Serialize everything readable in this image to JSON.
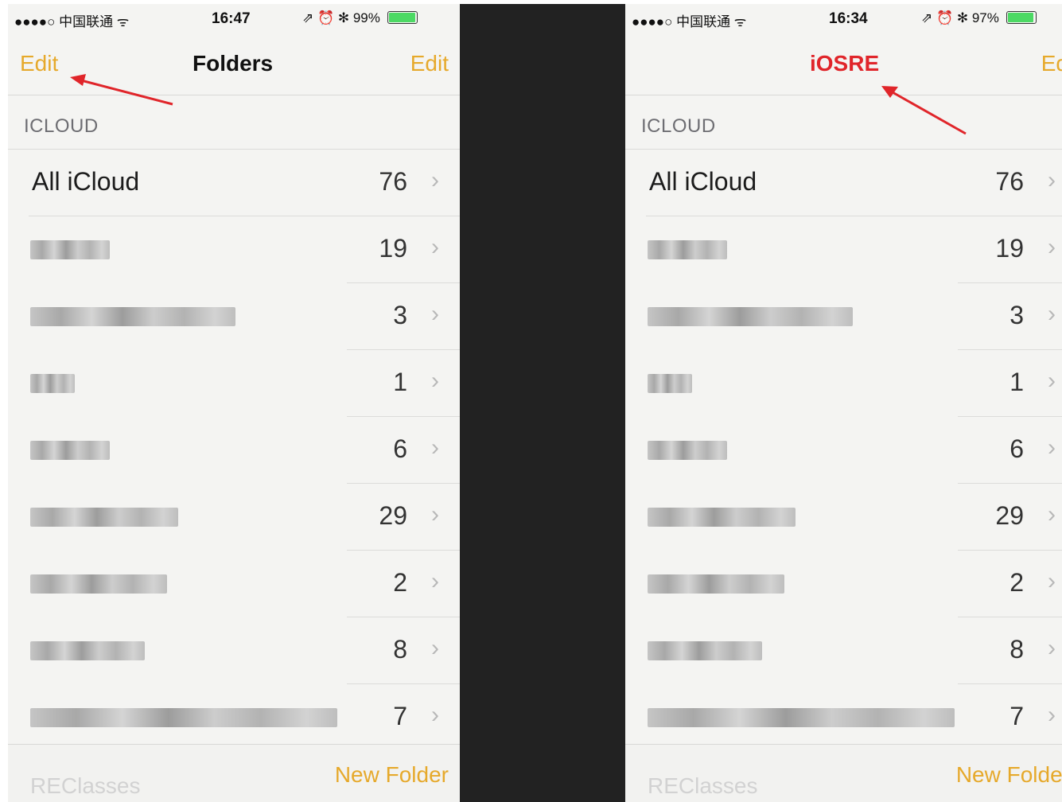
{
  "left_screen": {
    "status": {
      "carrier": "●●●●○ 中国联通 ᯤ",
      "time": "16:47",
      "icons": "⇗ ⏰ ✻ 99%",
      "battery_pct": 0.99
    },
    "nav": {
      "left": "Edit",
      "title": "Folders",
      "right": "Edit"
    },
    "section": "ICLOUD",
    "rows": [
      {
        "label": "All iCloud",
        "count": "76"
      },
      {
        "label": "",
        "count": "19"
      },
      {
        "label": "",
        "count": "3"
      },
      {
        "label": "",
        "count": "1"
      },
      {
        "label": "",
        "count": "6"
      },
      {
        "label": "",
        "count": "29"
      },
      {
        "label": "",
        "count": "2"
      },
      {
        "label": "",
        "count": "8"
      },
      {
        "label": "",
        "count": "7"
      }
    ],
    "toolbar": {
      "faded": "REClasses",
      "new_folder": "New Folder"
    }
  },
  "right_screen": {
    "status": {
      "carrier": "●●●●○ 中国联通 ᯤ",
      "time": "16:34",
      "icons": "⇗ ⏰ ✻ 97%",
      "battery_pct": 0.97
    },
    "nav": {
      "left": "",
      "title": "iOSRE",
      "right": "Edit"
    },
    "section": "ICLOUD",
    "rows": [
      {
        "label": "All iCloud",
        "count": "76"
      },
      {
        "label": "",
        "count": "19"
      },
      {
        "label": "",
        "count": "3"
      },
      {
        "label": "",
        "count": "1"
      },
      {
        "label": "",
        "count": "6"
      },
      {
        "label": "",
        "count": "29"
      },
      {
        "label": "",
        "count": "2"
      },
      {
        "label": "",
        "count": "8"
      },
      {
        "label": "",
        "count": "7"
      }
    ],
    "toolbar": {
      "faded": "REClasses",
      "new_folder": "New Folder"
    }
  },
  "chevron": "›",
  "colors": {
    "accent": "#e6a92b",
    "annotation": "#e0252a",
    "divider": "#222222"
  }
}
